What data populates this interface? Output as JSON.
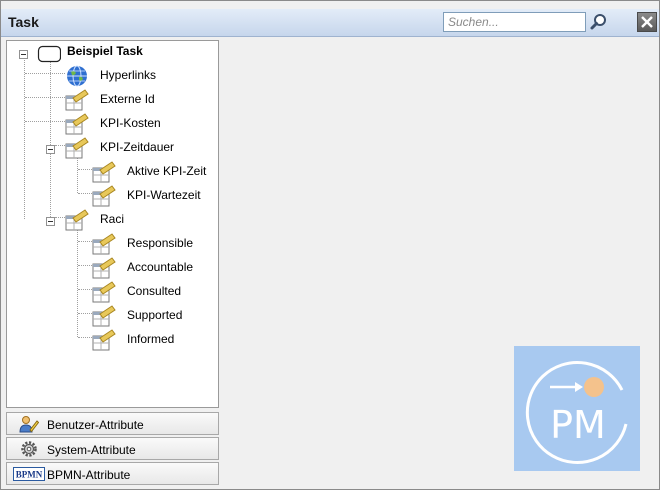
{
  "window": {
    "title": "Task",
    "search_placeholder": "Suchen...",
    "search_icon": "magnifier-icon",
    "close_icon": "close-icon"
  },
  "tree": {
    "root": {
      "label": "Beispiel Task",
      "icon": "task-shape-icon",
      "expanded": true
    },
    "items": [
      {
        "label": "Hyperlinks",
        "icon": "globe-icon"
      },
      {
        "label": "Externe Id",
        "icon": "attribute-table-icon"
      },
      {
        "label": "KPI-Kosten",
        "icon": "attribute-table-icon"
      },
      {
        "label": "KPI-Zeitdauer",
        "icon": "attribute-table-icon",
        "expanded": true,
        "children": [
          {
            "label": "Aktive KPI-Zeit",
            "icon": "attribute-table-icon"
          },
          {
            "label": "KPI-Wartezeit",
            "icon": "attribute-table-icon"
          }
        ]
      },
      {
        "label": "Raci",
        "icon": "attribute-table-icon",
        "expanded": true,
        "children": [
          {
            "label": "Responsible",
            "icon": "attribute-table-icon"
          },
          {
            "label": "Accountable",
            "icon": "attribute-table-icon"
          },
          {
            "label": "Consulted",
            "icon": "attribute-table-icon"
          },
          {
            "label": "Supported",
            "icon": "attribute-table-icon"
          },
          {
            "label": "Informed",
            "icon": "attribute-table-icon"
          }
        ]
      }
    ]
  },
  "bottom_tabs": [
    {
      "label": "Benutzer-Attribute",
      "icon": "user-pencil-icon"
    },
    {
      "label": "System-Attribute",
      "icon": "gear-icon"
    },
    {
      "label": "BPMN-Attribute",
      "icon": "bpmn-logo-icon",
      "icon_text": "BPMN"
    }
  ],
  "logo": {
    "text": "PM",
    "icon": "pm-logo-icon"
  },
  "colors": {
    "titlebar": "#c6d6ec",
    "logo_background": "#a8c9f0",
    "logo_foreground": "#ffffff",
    "logo_accent": "#f4c28c"
  }
}
